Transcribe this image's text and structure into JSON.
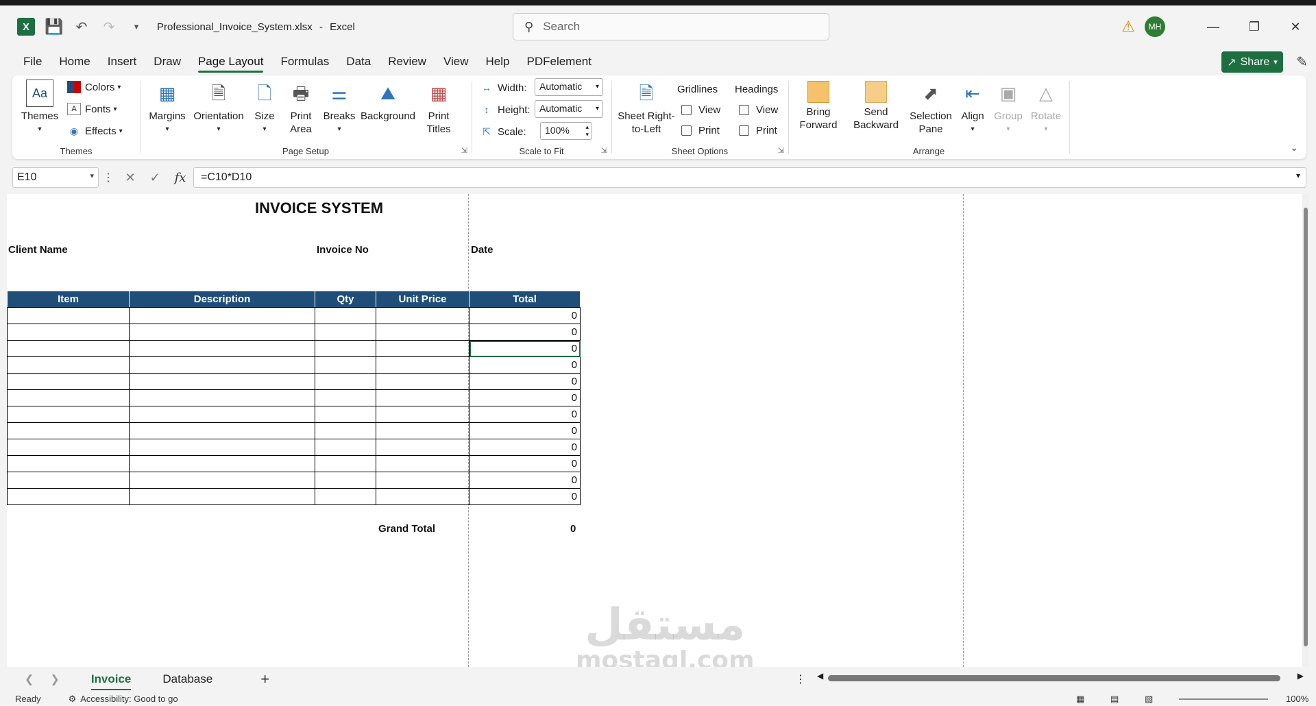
{
  "titlebar": {
    "filename": "Professional_Invoice_System.xlsx",
    "app": "Excel",
    "separator": "-",
    "search_placeholder": "Search",
    "avatar_initials": "MH"
  },
  "menu": {
    "tabs": [
      "File",
      "Home",
      "Insert",
      "Draw",
      "Page Layout",
      "Formulas",
      "Data",
      "Review",
      "View",
      "Help",
      "PDFelement"
    ],
    "active": "Page Layout",
    "share_label": "Share"
  },
  "ribbon": {
    "themes": {
      "themes": "Themes",
      "colors": "Colors",
      "fonts": "Fonts",
      "effects": "Effects",
      "group": "Themes"
    },
    "page_setup": {
      "margins": "Margins",
      "orientation": "Orientation",
      "size": "Size",
      "print_area": "Print Area",
      "breaks": "Breaks",
      "background": "Background",
      "print_titles": "Print Titles",
      "group": "Page Setup"
    },
    "scale": {
      "width_label": "Width:",
      "width_value": "Automatic",
      "height_label": "Height:",
      "height_value": "Automatic",
      "scale_label": "Scale:",
      "scale_value": "100%",
      "group": "Scale to Fit"
    },
    "sheet_options": {
      "rtl": "Sheet Right-to-Left",
      "gridlines": "Gridlines",
      "headings": "Headings",
      "view": "View",
      "print": "Print",
      "group": "Sheet Options"
    },
    "arrange": {
      "bring_forward": "Bring Forward",
      "send_backward": "Send Backward",
      "selection_pane": "Selection Pane",
      "align": "Align",
      "group_btn": "Group",
      "rotate": "Rotate",
      "group": "Arrange"
    }
  },
  "formula": {
    "name_box": "E10",
    "fx": "fx",
    "content": "=C10*D10"
  },
  "sheet": {
    "title": "INVOICE SYSTEM",
    "client_label": "Client Name",
    "invoice_label": "Invoice No",
    "date_label": "Date",
    "headers": [
      "Item",
      "Description",
      "Qty",
      "Unit Price",
      "Total"
    ],
    "totals": [
      "0",
      "0",
      "0",
      "0",
      "0",
      "0",
      "0",
      "0",
      "0",
      "0",
      "0",
      "0"
    ],
    "grand_total_label": "Grand Total",
    "grand_total_value": "0"
  },
  "sheet_tabs": {
    "tabs": [
      "Invoice",
      "Database"
    ],
    "active": "Invoice"
  },
  "status": {
    "ready": "Ready",
    "accessibility": "Accessibility: Good to go",
    "zoom": "100%"
  },
  "watermark": {
    "arabic": "مستقل",
    "latin": "mostaql.com"
  }
}
